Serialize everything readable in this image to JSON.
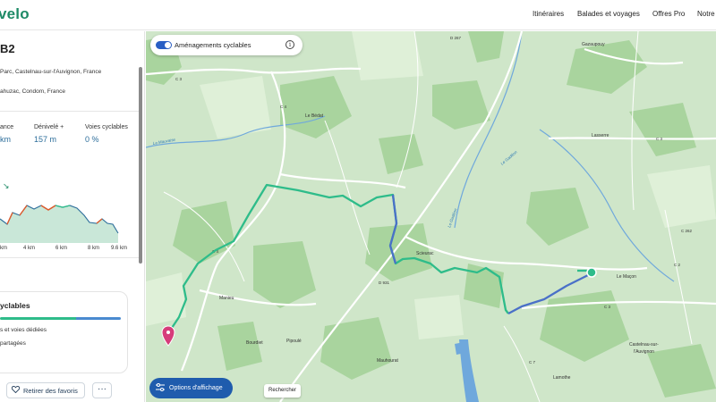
{
  "header": {
    "logo": "velo",
    "nav": [
      {
        "label": "Itinéraires"
      },
      {
        "label": "Balades et voyages"
      },
      {
        "label": "Offres Pro"
      },
      {
        "label": "Notre"
      }
    ]
  },
  "sidebar": {
    "title": "B2",
    "start_address": "Parc, Castelnau-sur-l'Auvignon, France",
    "end_address": "ahuzac, Condom, France",
    "stats": [
      {
        "label": "ance",
        "value": "km"
      },
      {
        "label": "Dénivelé +",
        "value": "157 m"
      },
      {
        "label": "Voies cyclables",
        "value": "0 %"
      }
    ],
    "profile_icon": "trend-arrow-icon",
    "profile_ticks": [
      "km",
      "4 km",
      "6 km",
      "8 km",
      "9.6 km"
    ],
    "profile_colors": {
      "line": "#2d6e9b",
      "climb": "#e05a2a",
      "flat": "#2ebc8a",
      "fill": "#c9e7d8"
    },
    "cycle_card": {
      "title": "yclables",
      "items": [
        "s et voies dédiées",
        "partagées"
      ],
      "share_dedicated": 0.63,
      "colors": {
        "dedicated": "#2ebc8a",
        "shared": "#4a8ad0"
      }
    },
    "favorite_button": "Retirer des favoris",
    "favorite_icon": "heart-icon",
    "more_icon": "more-icon",
    "more_label": "···"
  },
  "map": {
    "layer_toggle_label": "Aménagements cyclables",
    "layer_toggle_on": true,
    "info_icon": "info-icon",
    "info_glyph": "i",
    "display_button": "Options d'affichage",
    "display_icon": "sliders-icon",
    "search_button": "Rechercher",
    "route_color": "#2ebc8a",
    "route_color_alt": "#4a70c8",
    "start_marker_color": "#2ebc8a",
    "end_marker_color": "#d63c7a",
    "places": [
      "Gazaupouy",
      "Lasserre",
      "Le Bédat",
      "Scieurac",
      "Le Maçon",
      "Castelnau-sur-l'Auvignon",
      "Manieu",
      "Bourdiet",
      "Pipoulé",
      "Mauhourat",
      "Lamothe"
    ],
    "roads": [
      "D 267",
      "C 3",
      "C 4",
      "D 931",
      "C 7",
      "C 262",
      "C 2"
    ],
    "waters": [
      "La Mauvaise",
      "Le Gadéon",
      "Le Gadéon"
    ]
  }
}
